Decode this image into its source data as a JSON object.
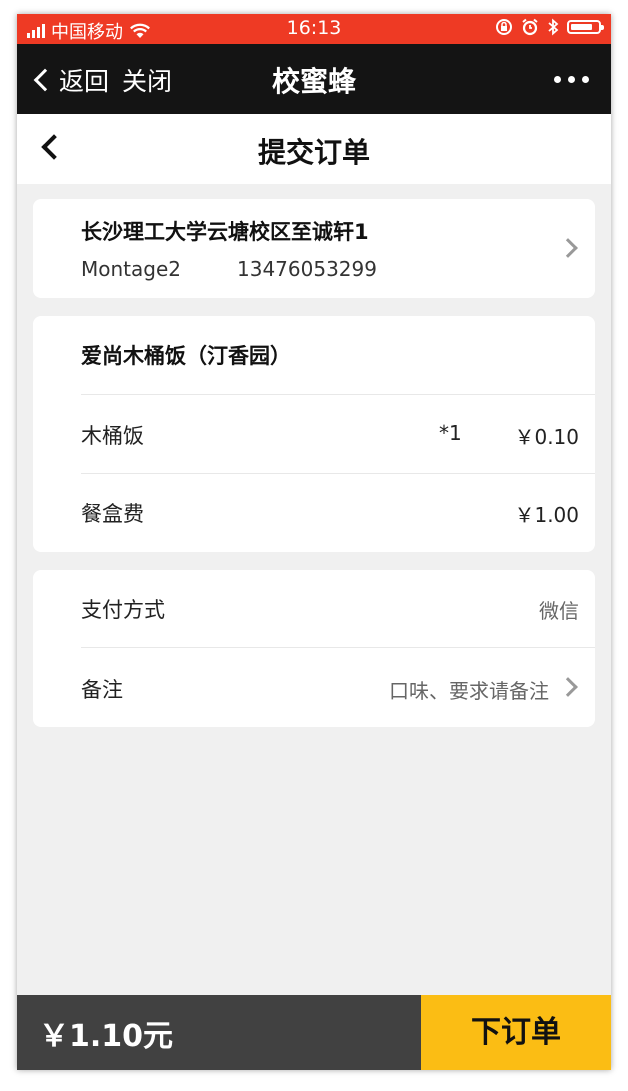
{
  "status_bar": {
    "carrier": "中国移动",
    "time": "16:13",
    "battery_level": 0.7
  },
  "wechat_nav": {
    "back_label": "返回",
    "close_label": "关闭",
    "title": "校蜜蜂"
  },
  "page": {
    "title": "提交订单"
  },
  "address": {
    "line": "长沙理工大学云塘校区至诚轩1",
    "name": "Montage2",
    "phone": "13476053299"
  },
  "order": {
    "shop_name": "爱尚木桶饭（汀香园）",
    "items": [
      {
        "name": "木桶饭",
        "qty": "*1",
        "price": "￥0.10"
      }
    ],
    "box_fee": {
      "label": "餐盒费",
      "price": "￥1.00"
    }
  },
  "payment": {
    "method_label": "支付方式",
    "method_value": "微信",
    "note_label": "备注",
    "note_placeholder": "口味、要求请备注"
  },
  "footer": {
    "total": "￥1.10元",
    "submit_label": "下订单"
  },
  "colors": {
    "status_bar": "#ee3a24",
    "nav_bar": "#141414",
    "submit_button": "#fbbd14",
    "total_bar": "#414141",
    "page_bg": "#f0f0f0"
  },
  "icons": [
    "signal-icon",
    "wifi-icon",
    "lock-rotation-icon",
    "alarm-icon",
    "bluetooth-icon",
    "battery-icon",
    "back-chevron-icon",
    "more-dots-icon",
    "chevron-right-icon"
  ]
}
